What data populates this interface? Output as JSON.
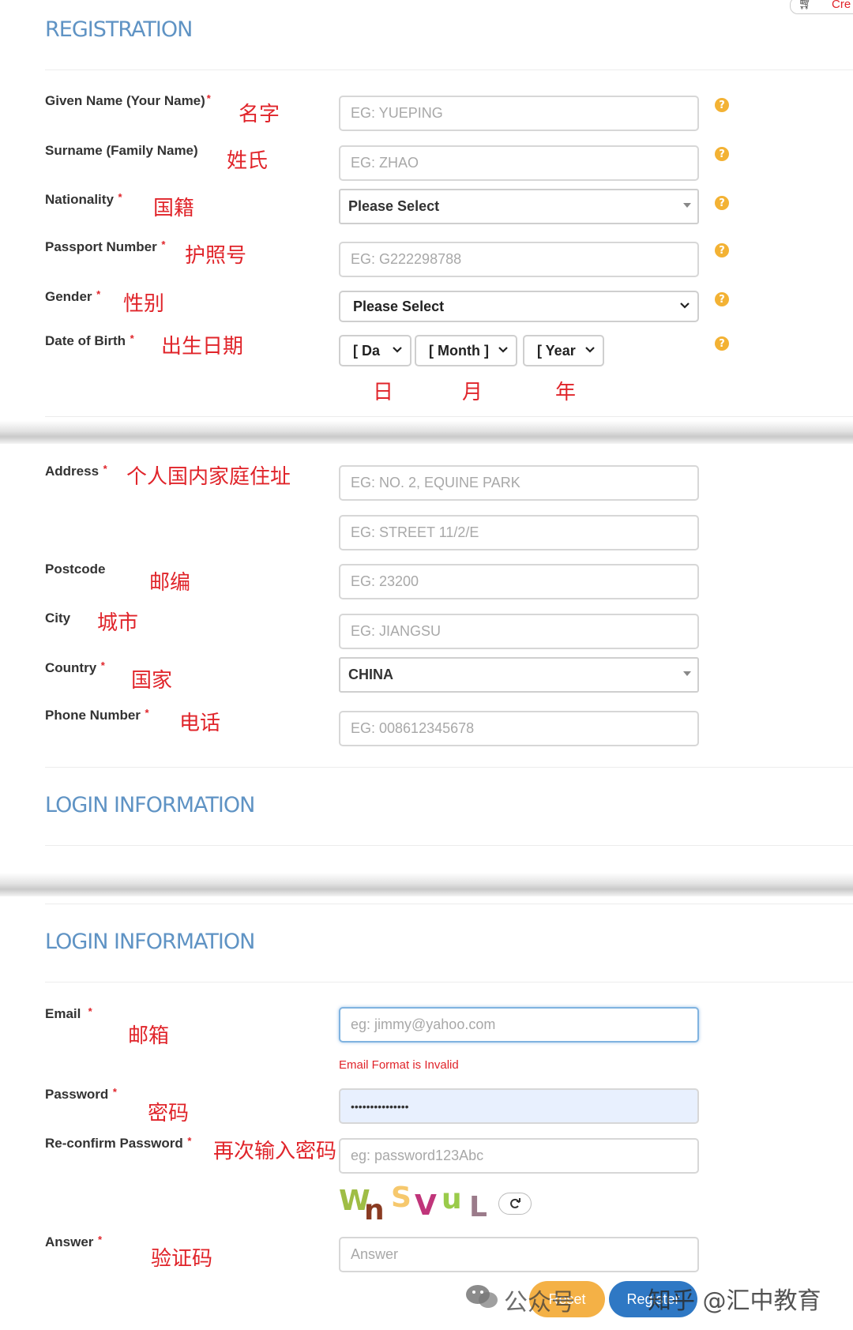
{
  "header": {
    "cart_link": "Cre"
  },
  "registration": {
    "title": "REGISTRATION",
    "given_name": {
      "label": "Given Name (Your Name)",
      "cn": "名字",
      "placeholder": "EG: YUEPING"
    },
    "surname": {
      "label": "Surname (Family Name)",
      "cn": "姓氏",
      "placeholder": "EG: ZHAO"
    },
    "nationality": {
      "label": "Nationality",
      "cn": "国籍",
      "value": "Please Select"
    },
    "passport": {
      "label": "Passport Number",
      "cn": "护照号",
      "placeholder": "EG: G222298788"
    },
    "gender": {
      "label": "Gender",
      "cn": "性别",
      "value": "Please Select"
    },
    "dob": {
      "label": "Date of Birth",
      "cn": "出生日期",
      "day": "[ Da",
      "month": "[ Month ]",
      "year": "[ Year",
      "day_cn": "日",
      "month_cn": "月",
      "year_cn": "年"
    },
    "address": {
      "label": "Address",
      "cn": "个人国内家庭住址",
      "placeholder1": "EG: NO. 2, EQUINE PARK",
      "placeholder2": "EG: STREET 11/2/E"
    },
    "postcode": {
      "label": "Postcode",
      "cn": "邮编",
      "placeholder": "EG: 23200"
    },
    "city": {
      "label": "City",
      "cn": "城市",
      "placeholder": "EG: JIANGSU"
    },
    "country": {
      "label": "Country",
      "cn": "国家",
      "value": "CHINA"
    },
    "phone": {
      "label": "Phone Number",
      "cn": "电话",
      "placeholder": "EG: 008612345678"
    }
  },
  "login": {
    "title": "LOGIN INFORMATION",
    "email": {
      "label": "Email",
      "cn": "邮箱",
      "placeholder": "eg: jimmy@yahoo.com",
      "error": "Email Format is Invalid"
    },
    "password": {
      "label": "Password",
      "cn": "密码",
      "value": "•••••••••••••••"
    },
    "reconfirm": {
      "label": "Re-confirm Password",
      "cn": "再次输入密码",
      "placeholder": "eg: password123Abc"
    },
    "captcha": [
      "W",
      "n",
      "S",
      "V",
      "u",
      "L"
    ],
    "answer": {
      "label": "Answer",
      "cn": "验证码",
      "placeholder": "Answer"
    }
  },
  "actions": {
    "reset": "Reset",
    "register": "Register"
  },
  "watermark": {
    "wechat": "公众号",
    "zhihu": "知乎 @汇中教育"
  },
  "colors": {
    "accent_blue": "#5f93c4",
    "required_red": "#e0242a",
    "help_yellow": "#f3b234",
    "reset_orange": "#f4b146",
    "register_blue": "#2f78c4"
  }
}
